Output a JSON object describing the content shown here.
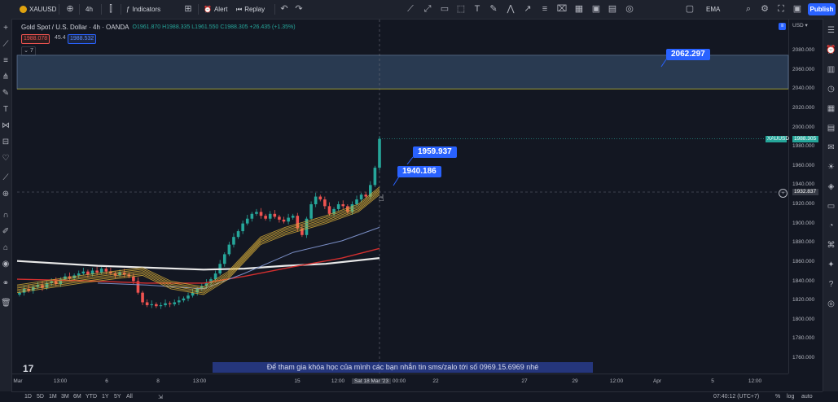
{
  "toolbar": {
    "symbol": "XAUUSD",
    "add_symbol_icon": "plus-icon",
    "interval": "4h",
    "indicators_label": "Indicators",
    "alert_label": "Alert",
    "replay_label": "Replay",
    "ema_label": "EMA",
    "publish_label": "Publish"
  },
  "legend": {
    "title": "Gold Spot / U.S. Dollar · 4h · OANDA",
    "ohlc": "O1961.870 H1988.335 L1961.550 C1988.305 +26.435 (+1.35%)",
    "bid": "1988.078",
    "spread": "45.4",
    "ask": "1988.532",
    "collapse_label": "7"
  },
  "axis": {
    "currency": "USD",
    "price_ticks": [
      "2080.000",
      "2060.000",
      "2040.000",
      "2020.000",
      "2000.000",
      "1980.000",
      "1960.000",
      "1940.000",
      "1920.000",
      "1900.000",
      "1880.000",
      "1860.000",
      "1840.000",
      "1820.000",
      "1800.000",
      "1780.000",
      "1760.000"
    ],
    "current_symbol_label": "XAUUSD",
    "current_price": "1988.305",
    "crosshair_price": "1932.837",
    "time_labels": [
      "Mar",
      "13:00",
      "6",
      "8",
      "13:00",
      "15",
      "12:00",
      "Sat 18 Mar '23",
      "00:00",
      "22",
      "27",
      "29",
      "12:00",
      "Apr",
      "5",
      "12:00"
    ]
  },
  "annotations": {
    "zone_top": "2062.297",
    "label_1": "1959.937",
    "label_2": "1940.186"
  },
  "caption": "Để tham gia khóa học của mình các bạn nhắn tin sms/zalo tới số 0969.15.6969 nhé",
  "bottombar": {
    "ranges": [
      "1D",
      "5D",
      "1M",
      "3M",
      "6M",
      "YTD",
      "1Y",
      "5Y",
      "All"
    ],
    "time": "07:40:12 (UTC+7)",
    "percent": "%",
    "log": "log",
    "auto": "auto"
  },
  "colors": {
    "background": "#131722",
    "bullish": "#26a69a",
    "bearish": "#ef5350",
    "accent": "#2962ff",
    "zone_fill": "#3d5878",
    "ma_white": "#e8e8e8",
    "ma_red": "#d32f2f",
    "ma_blue": "#7b8fc7",
    "ribbon": "#e0b43a"
  }
}
